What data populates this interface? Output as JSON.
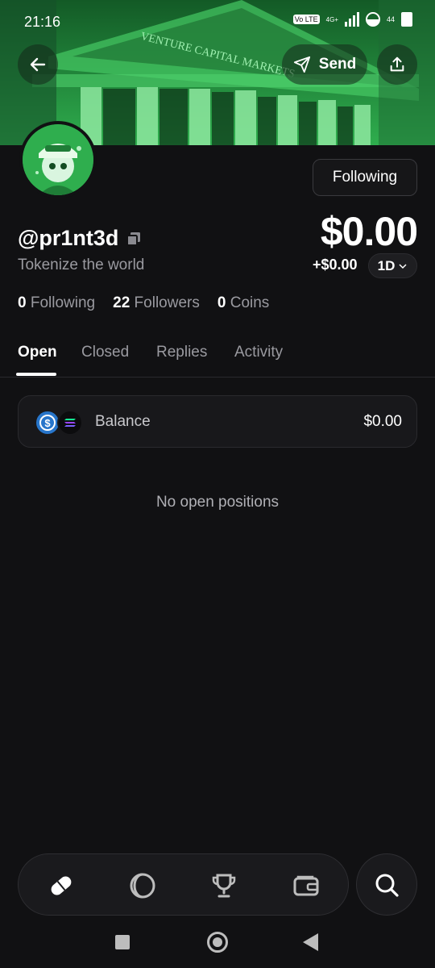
{
  "status_bar": {
    "time": "21:16",
    "network": "4G+",
    "volte": "Vo LTE",
    "battery": "44"
  },
  "banner": {
    "image_text": "VENTURE CAPITAL MARKETS",
    "tint": "#2fbf55"
  },
  "header": {
    "send_label": "Send"
  },
  "profile": {
    "handle": "@pr1nt3d",
    "bio": "Tokenize the world",
    "follow_label": "Following",
    "balance": "$0.00",
    "change": "+$0.00",
    "period": "1D",
    "stats": {
      "following_count": "0",
      "following_label": "Following",
      "followers_count": "22",
      "followers_label": "Followers",
      "coins_count": "0",
      "coins_label": "Coins"
    }
  },
  "tabs": [
    "Open",
    "Closed",
    "Replies",
    "Activity"
  ],
  "active_tab": "Open",
  "balance_card": {
    "label": "Balance",
    "value": "$0.00",
    "icons": [
      "usdc-icon",
      "solana-icon"
    ]
  },
  "empty_state": "No open positions",
  "bottom_nav": {
    "items": [
      "pill-icon",
      "moon-icon",
      "trophy-icon",
      "wallet-icon"
    ],
    "search": "search-icon"
  },
  "colors": {
    "background": "#111113",
    "accent": "#2fbf55",
    "muted": "#9a9aa0"
  }
}
